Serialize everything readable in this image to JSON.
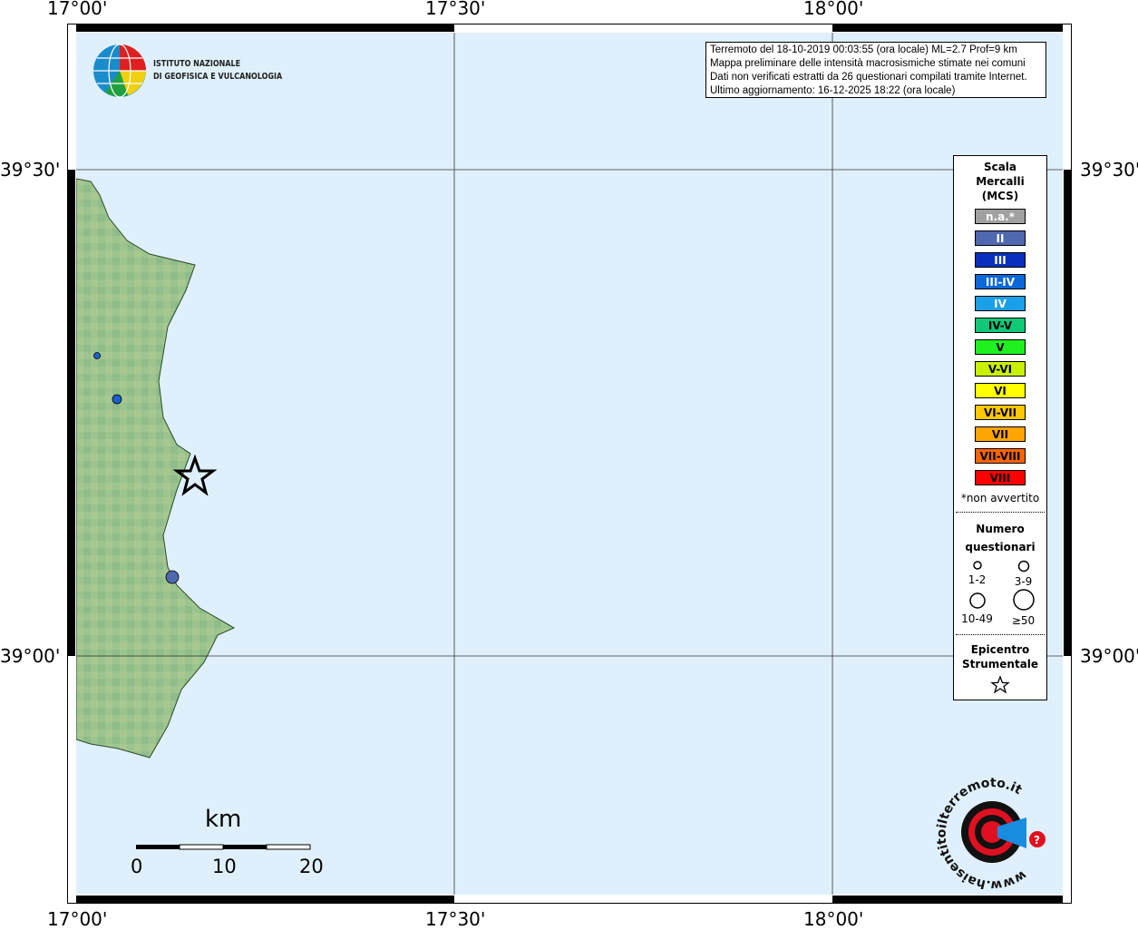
{
  "axes": {
    "lon_ticks": [
      "17°00'",
      "17°30'",
      "18°00'"
    ],
    "lat_ticks": [
      "39°30'",
      "39°00'"
    ]
  },
  "institute": {
    "line1": "ISTITUTO NAZIONALE",
    "line2": "DI GEOFISICA E VULCANOLOGIA"
  },
  "info": {
    "line1": "Terremoto del 18-10-2019 00:03:55 (ora locale) ML=2.7 Prof=9 km",
    "line2": "Mappa preliminare delle intensità macrosismiche stimate nei comuni",
    "line3": "Dati non verificati estratti da 26 questionari compilati tramite Internet.",
    "line4": "Ultimo aggiornamento: 16-12-2025 18:22 (ora locale)"
  },
  "legend": {
    "title": [
      "Scala",
      "Mercalli",
      "(MCS)"
    ],
    "scale": [
      {
        "label": "n.a.*",
        "color": "#a0a0a0",
        "text": "#fff"
      },
      {
        "label": "II",
        "color": "#5068b0",
        "text": "#fff"
      },
      {
        "label": "III",
        "color": "#0a2fbf",
        "text": "#fff"
      },
      {
        "label": "III-IV",
        "color": "#0a68d8",
        "text": "#fff"
      },
      {
        "label": "IV",
        "color": "#1aa0e8",
        "text": "#fff"
      },
      {
        "label": "IV-V",
        "color": "#10c878",
        "text": "#000"
      },
      {
        "label": "V",
        "color": "#20f020",
        "text": "#000"
      },
      {
        "label": "V-VI",
        "color": "#c8f000",
        "text": "#000"
      },
      {
        "label": "VI",
        "color": "#ffff00",
        "text": "#000"
      },
      {
        "label": "VI-VII",
        "color": "#ffc800",
        "text": "#000"
      },
      {
        "label": "VII",
        "color": "#ffa500",
        "text": "#000"
      },
      {
        "label": "VII-VIII",
        "color": "#ff6400",
        "text": "#000"
      },
      {
        "label": "VIII",
        "color": "#ff0000",
        "text": "#000"
      }
    ],
    "note": "*non avvertito",
    "questionnaires_title": [
      "Numero",
      "questionari"
    ],
    "sizes": [
      "1-2",
      "3-9",
      "10-49",
      "≥50"
    ],
    "epicenter_title": [
      "Epicentro",
      "Strumentale"
    ]
  },
  "markers": [
    {
      "intensity": "III-IV",
      "color": "#1a60d0"
    },
    {
      "intensity": "III-IV",
      "color": "#1a60d0"
    },
    {
      "intensity": "II",
      "color": "#5068b0"
    }
  ],
  "scalebar": {
    "unit": "km",
    "labels": [
      "0",
      "10",
      "20"
    ]
  },
  "logo": {
    "text": "www.haisentitoilterremoto.it"
  }
}
